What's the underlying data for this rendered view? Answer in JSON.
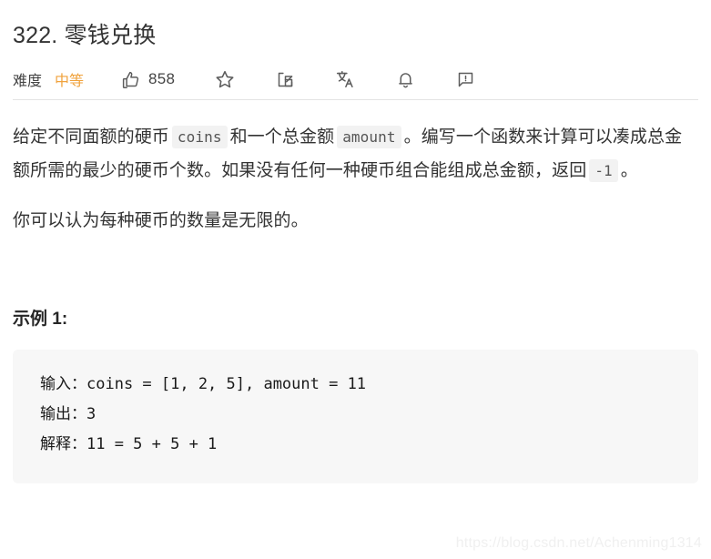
{
  "problem": {
    "title": "322. 零钱兑换",
    "difficulty_label": "难度",
    "difficulty_value": "中等",
    "difficulty_color": "#f0a23c"
  },
  "actions": {
    "vote": {
      "icon": "thumbs-up-icon",
      "count": "858"
    },
    "favorite": {
      "icon": "star-icon"
    },
    "share": {
      "icon": "share-icon"
    },
    "translate": {
      "icon": "translate-icon"
    },
    "notify": {
      "icon": "bell-icon"
    },
    "report": {
      "icon": "feedback-icon"
    }
  },
  "description": {
    "p1_part1": "给定不同面额的硬币",
    "p1_code1": "coins",
    "p1_part2": "和一个总金额",
    "p1_code2": "amount",
    "p1_part3": "。编写一个函数来计算可以凑成总金额所需的最少的硬币个数。如果没有任何一种硬币组合能组成总金额，返回",
    "p1_code3": "-1",
    "p1_part4": "。",
    "p2": "你可以认为每种硬币的数量是无限的。"
  },
  "example": {
    "heading": "示例 1:",
    "lines": [
      "输入：coins = [1, 2, 5], amount = 11",
      "输出：3",
      "解释：11 = 5 + 5 + 1"
    ]
  },
  "watermark": "https://blog.csdn.net/Achenming1314"
}
